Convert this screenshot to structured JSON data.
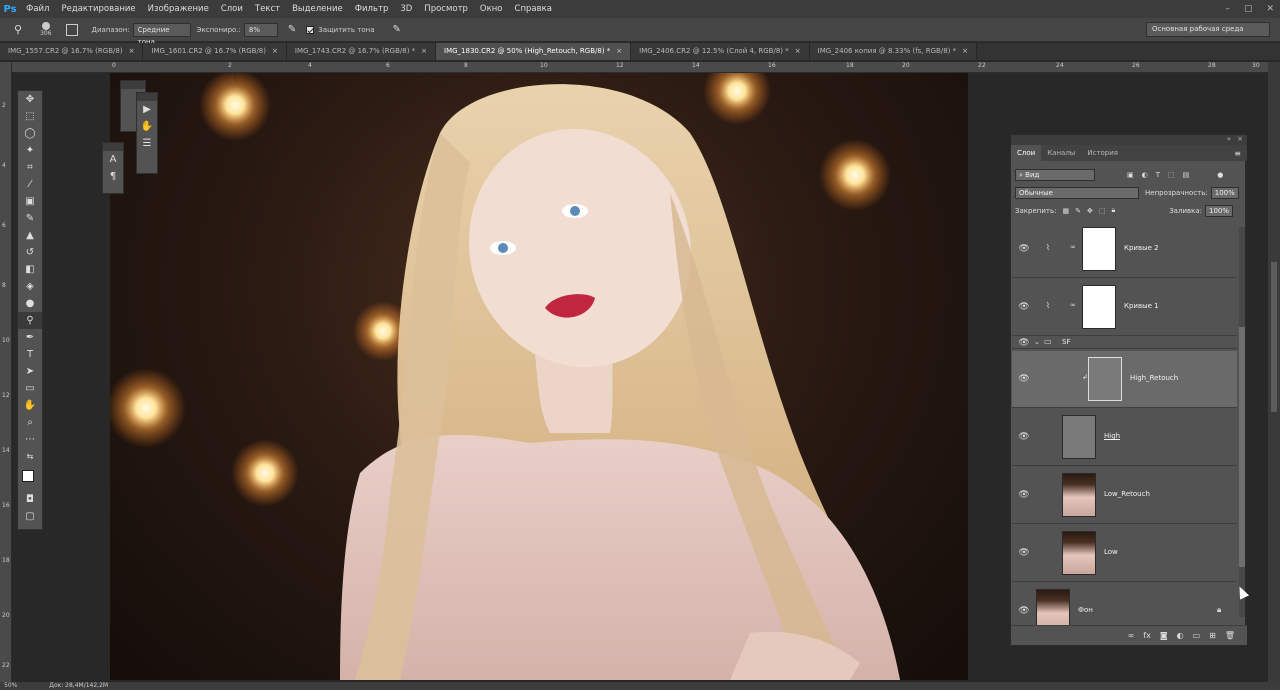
{
  "menubar": {
    "logo": "Ps",
    "items": [
      "Файл",
      "Редактирование",
      "Изображение",
      "Слои",
      "Текст",
      "Выделение",
      "Фильтр",
      "3D",
      "Просмотр",
      "Окно",
      "Справка"
    ],
    "window_controls": [
      "–",
      "▢",
      "✕"
    ]
  },
  "options": {
    "brush_size": "306",
    "range_label": "Диапазон:",
    "range_value": "Средние тона",
    "exposure_label": "Экспониро.:",
    "exposure_value": "8%",
    "protect_label": "Защитить тона",
    "workspace": "Основная рабочая среда"
  },
  "tabs": [
    {
      "label": "IMG_1557.CR2 @ 16.7% (RGB/8)",
      "active": false
    },
    {
      "label": "IMG_1601.CR2 @ 16.7% (RGB/8)",
      "active": false
    },
    {
      "label": "IMG_1743.CR2 @ 16.7% (RGB/8) *",
      "active": false
    },
    {
      "label": "IMG_1830.CR2 @ 50% (High_Retouch, RGB/8) *",
      "active": true
    },
    {
      "label": "IMG_2406.CR2 @ 12.5% (Слой 4, RGB/8) *",
      "active": false
    },
    {
      "label": "IMG_2406 копия @ 8.33% (fs, RGB/8) *",
      "active": false
    }
  ],
  "ruler": {
    "top_ticks": [
      "0",
      "2",
      "4",
      "6",
      "8",
      "10",
      "12",
      "14",
      "16",
      "18",
      "20",
      "22",
      "24",
      "26",
      "28",
      "30"
    ],
    "left_ticks": [
      "2",
      "4",
      "6",
      "8",
      "10",
      "12",
      "14",
      "16",
      "18",
      "20",
      "22"
    ]
  },
  "layers_panel": {
    "tabs": [
      "Слои",
      "Каналы",
      "История"
    ],
    "filter_label": "Вид",
    "blend_mode": "Обычные",
    "opacity_label": "Непрозрачность:",
    "opacity_value": "100%",
    "lock_label": "Закрепить:",
    "fill_label": "Заливка:",
    "fill_value": "100%",
    "group_name": "SF",
    "layers": [
      {
        "name": "Кривые 2",
        "type": "adjustment"
      },
      {
        "name": "Кривые 1",
        "type": "adjustment"
      },
      {
        "name": "High_Retouch",
        "type": "gray",
        "selected": true
      },
      {
        "name": "High",
        "type": "gray"
      },
      {
        "name": "Low_Retouch",
        "type": "photo"
      },
      {
        "name": "Low",
        "type": "photo"
      },
      {
        "name": "Фон",
        "type": "photo",
        "locked": true
      }
    ]
  },
  "status": {
    "zoom": "50%",
    "doc": "Док: 28,4M/142,2M"
  }
}
